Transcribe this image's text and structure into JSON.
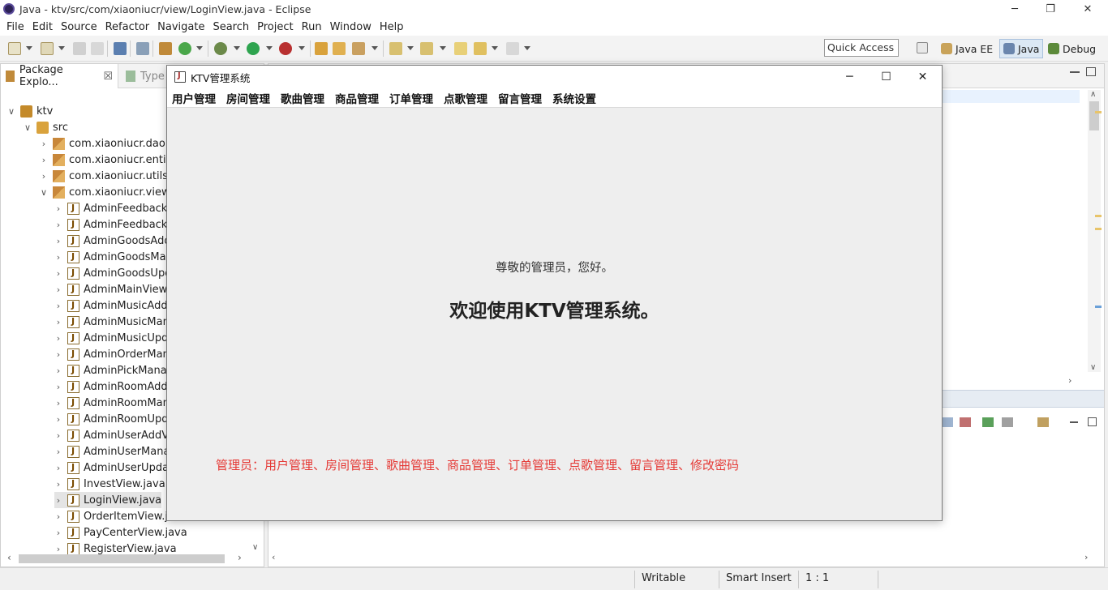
{
  "eclipse": {
    "title": "Java - ktv/src/com/xiaoniucr/view/LoginView.java - Eclipse",
    "menu": [
      "File",
      "Edit",
      "Source",
      "Refactor",
      "Navigate",
      "Search",
      "Project",
      "Run",
      "Window",
      "Help"
    ],
    "quick_access": "Quick Access",
    "perspectives": [
      "Java EE",
      "Java",
      "Debug"
    ],
    "package_explorer": {
      "tab_label": "Package Explo...",
      "tab_close": "☒",
      "type_tab_label": "Type",
      "tree": [
        {
          "label": "ktv",
          "kind": "project",
          "depth": 0,
          "expanded": true
        },
        {
          "label": "src",
          "kind": "src",
          "depth": 1,
          "expanded": true
        },
        {
          "label": "com.xiaoniucr.dao",
          "kind": "package",
          "depth": 2,
          "expanded": false
        },
        {
          "label": "com.xiaoniucr.entity",
          "kind": "package",
          "depth": 2,
          "expanded": false
        },
        {
          "label": "com.xiaoniucr.utils",
          "kind": "package",
          "depth": 2,
          "expanded": false
        },
        {
          "label": "com.xiaoniucr.view",
          "kind": "package",
          "depth": 2,
          "expanded": true
        },
        {
          "label": "AdminFeedbackM",
          "kind": "java",
          "depth": 3
        },
        {
          "label": "AdminFeedbackR",
          "kind": "java",
          "depth": 3
        },
        {
          "label": "AdminGoodsAdd",
          "kind": "java",
          "depth": 3
        },
        {
          "label": "AdminGoodsMan",
          "kind": "java",
          "depth": 3
        },
        {
          "label": "AdminGoodsUpd",
          "kind": "java",
          "depth": 3
        },
        {
          "label": "AdminMainView.j",
          "kind": "java",
          "depth": 3
        },
        {
          "label": "AdminMusicAddV",
          "kind": "java",
          "depth": 3
        },
        {
          "label": "AdminMusicMana",
          "kind": "java",
          "depth": 3
        },
        {
          "label": "AdminMusicUpda",
          "kind": "java",
          "depth": 3
        },
        {
          "label": "AdminOrderMana",
          "kind": "java",
          "depth": 3
        },
        {
          "label": "AdminPickManag",
          "kind": "java",
          "depth": 3
        },
        {
          "label": "AdminRoomAddV",
          "kind": "java",
          "depth": 3
        },
        {
          "label": "AdminRoomMana",
          "kind": "java",
          "depth": 3
        },
        {
          "label": "AdminRoomUpda",
          "kind": "java",
          "depth": 3
        },
        {
          "label": "AdminUserAddVi",
          "kind": "java",
          "depth": 3
        },
        {
          "label": "AdminUserManag",
          "kind": "java",
          "depth": 3
        },
        {
          "label": "AdminUserUpdat",
          "kind": "java",
          "depth": 3
        },
        {
          "label": "InvestView.java",
          "kind": "java",
          "depth": 3
        },
        {
          "label": "LoginView.java",
          "kind": "java",
          "depth": 3,
          "selected": true
        },
        {
          "label": "OrderItemView.java",
          "kind": "java",
          "depth": 3
        },
        {
          "label": "PayCenterView.java",
          "kind": "java",
          "depth": 3
        },
        {
          "label": "RegisterView.java",
          "kind": "java",
          "depth": 3
        }
      ]
    },
    "status": {
      "writable": "Writable",
      "insert_mode": "Smart Insert",
      "position": "1 : 1"
    }
  },
  "ktv": {
    "title": "KTV管理系统",
    "menu": [
      "用户管理",
      "房间管理",
      "歌曲管理",
      "商品管理",
      "订单管理",
      "点歌管理",
      "留言管理",
      "系统设置"
    ],
    "greeting": "尊敬的管理员，您好。",
    "welcome": "欢迎使用KTV管理系统。",
    "permissions": "管理员：用户管理、房间管理、歌曲管理、商品管理、订单管理、点歌管理、留言管理、修改密码",
    "permission_color": "#e53935"
  }
}
